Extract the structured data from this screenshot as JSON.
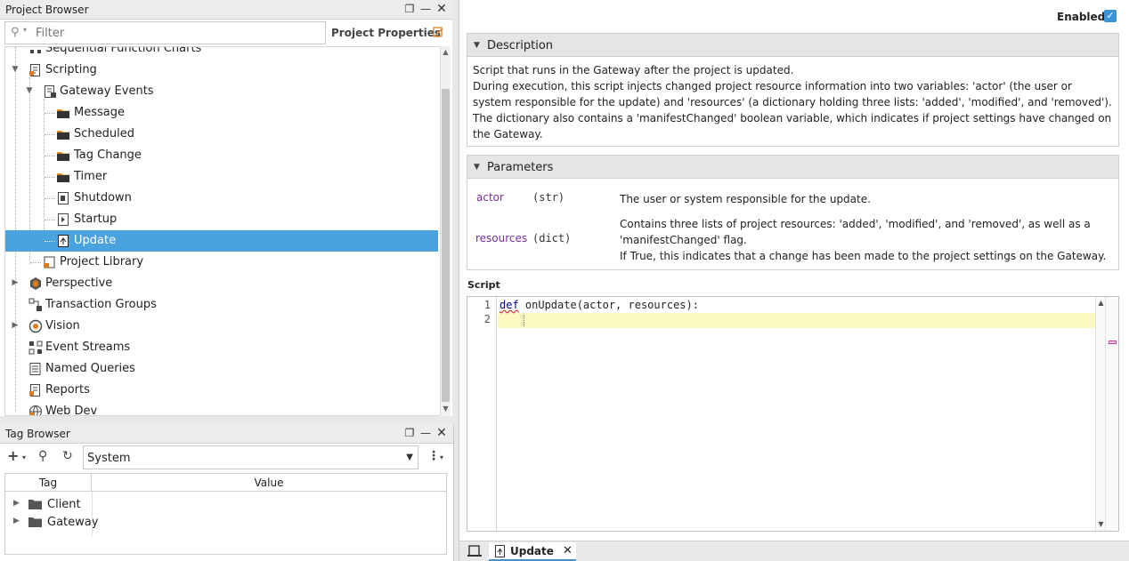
{
  "project_browser": {
    "title": "Project Browser",
    "filter_placeholder": "Filter",
    "project_properties": "Project Properties",
    "tree": [
      {
        "label": "Sequential Function Charts"
      },
      {
        "label": "Scripting"
      },
      {
        "label": "Gateway Events"
      },
      {
        "label": "Message"
      },
      {
        "label": "Scheduled"
      },
      {
        "label": "Tag Change"
      },
      {
        "label": "Timer"
      },
      {
        "label": "Shutdown"
      },
      {
        "label": "Startup"
      },
      {
        "label": "Update"
      },
      {
        "label": "Project Library"
      },
      {
        "label": "Perspective"
      },
      {
        "label": "Transaction Groups"
      },
      {
        "label": "Vision"
      },
      {
        "label": "Event Streams"
      },
      {
        "label": "Named Queries"
      },
      {
        "label": "Reports"
      },
      {
        "label": "Web Dev"
      }
    ]
  },
  "tag_browser": {
    "title": "Tag Browser",
    "provider": "System",
    "columns": [
      "Tag",
      "Value"
    ],
    "rows": [
      {
        "label": "Client"
      },
      {
        "label": "Gateway"
      }
    ]
  },
  "editor": {
    "enabled_label": "Enabled",
    "enabled": true,
    "description": {
      "title": "Description",
      "lines": [
        "Script that runs in the Gateway after the project is updated.",
        "During execution, this script injects changed project resource information into two variables: 'actor' (the user or system responsible for the update) and 'resources' (a dictionary holding three lists: 'added', 'modified', and 'removed').",
        "The dictionary also contains a 'manifestChanged' boolean variable, which indicates if project settings have changed on the Gateway."
      ]
    },
    "parameters": {
      "title": "Parameters",
      "items": [
        {
          "name": "actor",
          "type": "(str)",
          "desc": "The user or system responsible for the update."
        },
        {
          "name": "resources",
          "type": "(dict)",
          "desc_lines": [
            "Contains three lists of project resources: 'added', 'modified', and 'removed', as well as a 'manifestChanged' flag.",
            "If True, this indicates that a change has been made to the project settings on the Gateway."
          ]
        }
      ]
    },
    "script_label": "Script",
    "code": {
      "line_numbers": [
        "1",
        "2"
      ],
      "keyword": "def",
      "rest": " onUpdate(actor, resources):"
    },
    "tab": {
      "label": "Update",
      "close": "✕"
    }
  },
  "colors": {
    "selection": "#4aa3df",
    "accent": "#3b93d8",
    "param_name": "#7b2f96",
    "current_line": "#fbf8c2"
  }
}
